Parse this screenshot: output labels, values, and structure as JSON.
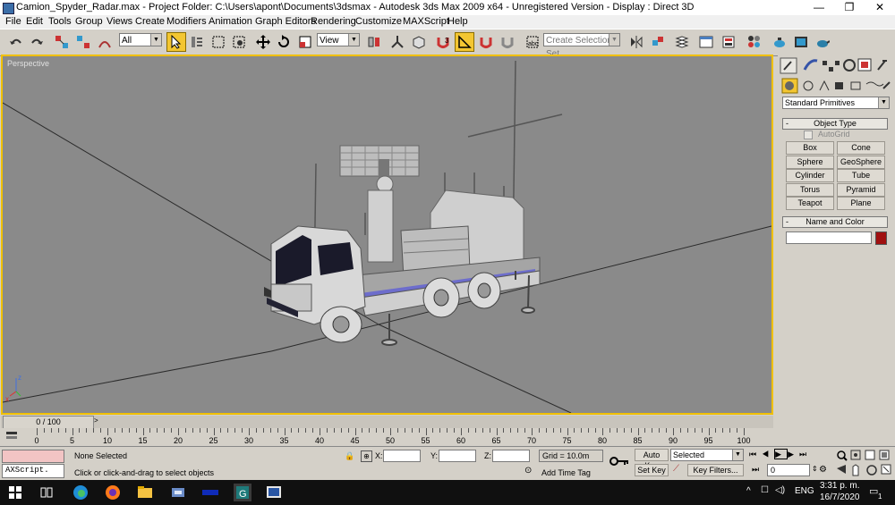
{
  "window": {
    "title": "Camion_Spyder_Radar.max    - Project Folder: C:\\Users\\apont\\Documents\\3dsmax    - Autodesk 3ds Max  2009 x64  - Unregistered Version   - Display : Direct 3D",
    "minimize": "—",
    "maximize": "❐",
    "close": "✕"
  },
  "menu": [
    "File",
    "Edit",
    "Tools",
    "Group",
    "Views",
    "Create",
    "Modifiers",
    "Animation",
    "Graph Editors",
    "Rendering",
    "Customize",
    "MAXScript",
    "Help"
  ],
  "toolbar": {
    "selection_filter": "All",
    "ref_coord": "View",
    "named_selection_placeholder": "Create Selection Set"
  },
  "viewport": {
    "label": "Perspective",
    "axis_z": "z",
    "axis_x": "x"
  },
  "command_panel": {
    "category_dropdown": "Standard Primitives",
    "object_type_title": "Object Type",
    "autogrid_label": "AutoGrid",
    "buttons": [
      "Box",
      "Cone",
      "Sphere",
      "GeoSphere",
      "Cylinder",
      "Tube",
      "Torus",
      "Pyramid",
      "Teapot",
      "Plane"
    ],
    "name_color_title": "Name and Color",
    "object_name": "",
    "object_color": "#a01010"
  },
  "time_slider": {
    "label": "0 / 100",
    "ticks": [
      "0",
      "5",
      "10",
      "15",
      "20",
      "25",
      "30",
      "35",
      "40",
      "45",
      "50",
      "55",
      "60",
      "65",
      "70",
      "75",
      "80",
      "85",
      "90",
      "95",
      "100"
    ]
  },
  "status": {
    "maxscript_listener": "AXScript.",
    "selection": "None Selected",
    "prompt": "Click or click-and-drag to select objects",
    "x_label": "X:",
    "y_label": "Y:",
    "z_label": "Z:",
    "x_value": "",
    "y_value": "",
    "z_value": "",
    "grid": "Grid = 10.0m",
    "add_time_tag": "Add Time Tag",
    "auto_key": "Auto Key",
    "set_key": "Set Key",
    "key_mode": "Selected",
    "key_filters": "Key Filters...",
    "current_frame": "0"
  },
  "taskbar": {
    "language": "ENG",
    "time": "3:31 p. m.",
    "date": "16/7/2020",
    "notification_count": "1"
  },
  "colors": {
    "viewport_bg": "#8a8a8a",
    "active_border": "#f0c000",
    "active_tool": "#f3c632",
    "taskbar": "#101010"
  }
}
